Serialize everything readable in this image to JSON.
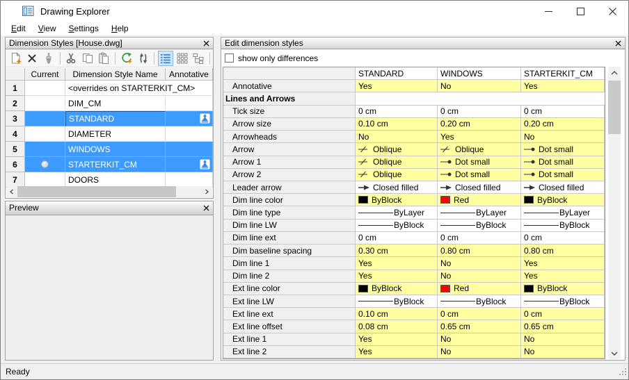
{
  "window": {
    "title": "Drawing Explorer",
    "buttons": [
      "minimize",
      "maximize",
      "close"
    ],
    "status": "Ready"
  },
  "menu": {
    "items": [
      {
        "label": "Edit"
      },
      {
        "label": "View"
      },
      {
        "label": "Settings"
      },
      {
        "label": "Help"
      }
    ]
  },
  "left_panel": {
    "title": "Dimension Styles [House.dwg]",
    "toolbar": [
      {
        "icon": "new-style"
      },
      {
        "icon": "delete"
      },
      {
        "icon": "purge"
      },
      {
        "sep": true
      },
      {
        "icon": "cut"
      },
      {
        "icon": "copy"
      },
      {
        "icon": "paste"
      },
      {
        "sep": true
      },
      {
        "icon": "regenerate"
      },
      {
        "icon": "refresh"
      },
      {
        "sep": true
      },
      {
        "icon": "details-view",
        "active": true
      },
      {
        "icon": "icons-view"
      },
      {
        "icon": "tree-view"
      },
      {
        "sep": true
      }
    ],
    "table": {
      "columns": [
        "",
        "Current",
        "Dimension Style Name",
        "Annotative"
      ],
      "rows": [
        {
          "num": "1",
          "name": "<overrides on STARTERKIT_CM>",
          "current": false,
          "annotative": false,
          "selected": false
        },
        {
          "num": "2",
          "name": "DIM_CM",
          "current": false,
          "annotative": false,
          "selected": false
        },
        {
          "num": "3",
          "name": "STANDARD",
          "current": false,
          "annotative": true,
          "selected": true,
          "focus": true
        },
        {
          "num": "4",
          "name": "DIAMETER",
          "current": false,
          "annotative": false,
          "selected": false
        },
        {
          "num": "5",
          "name": "WINDOWS",
          "current": false,
          "annotative": false,
          "selected": true
        },
        {
          "num": "6",
          "name": "STARTERKIT_CM",
          "current": true,
          "annotative": true,
          "selected": true
        },
        {
          "num": "7",
          "name": "DOORS",
          "current": false,
          "annotative": false,
          "selected": false
        }
      ]
    }
  },
  "preview_panel": {
    "title": "Preview"
  },
  "right_panel": {
    "title": "Edit dimension styles",
    "checkbox_label": "show only differences",
    "checkbox_checked": false,
    "table": {
      "columns": [
        "",
        "STANDARD",
        "WINDOWS",
        "STARTERKIT_CM"
      ],
      "rows": [
        {
          "label": "Annotative",
          "diff": true,
          "cells": [
            {
              "text": "Yes"
            },
            {
              "text": "No"
            },
            {
              "text": "Yes"
            }
          ]
        },
        {
          "label": "Lines and Arrows",
          "category": true
        },
        {
          "label": "Tick size",
          "diff": false,
          "cells": [
            {
              "text": "0 cm"
            },
            {
              "text": "0 cm"
            },
            {
              "text": "0 cm"
            }
          ]
        },
        {
          "label": "Arrow size",
          "diff": true,
          "cells": [
            {
              "text": "0.10 cm"
            },
            {
              "text": "0.20 cm"
            },
            {
              "text": "0.20 cm"
            }
          ]
        },
        {
          "label": "Arrowheads",
          "diff": true,
          "cells": [
            {
              "text": "No"
            },
            {
              "text": "Yes"
            },
            {
              "text": "No"
            }
          ]
        },
        {
          "label": "Arrow",
          "diff": true,
          "cells": [
            {
              "icon": "oblique",
              "text": "Oblique"
            },
            {
              "icon": "oblique",
              "text": "Oblique"
            },
            {
              "icon": "dot-small",
              "text": "Dot small"
            }
          ]
        },
        {
          "label": "Arrow 1",
          "diff": true,
          "cells": [
            {
              "icon": "oblique",
              "text": "Oblique"
            },
            {
              "icon": "dot-small",
              "text": "Dot small"
            },
            {
              "icon": "dot-small",
              "text": "Dot small"
            }
          ]
        },
        {
          "label": "Arrow 2",
          "diff": true,
          "cells": [
            {
              "icon": "oblique",
              "text": "Oblique"
            },
            {
              "icon": "dot-small",
              "text": "Dot small"
            },
            {
              "icon": "dot-small",
              "text": "Dot small"
            }
          ]
        },
        {
          "label": "Leader arrow",
          "diff": false,
          "cells": [
            {
              "icon": "closed-filled",
              "text": "Closed filled"
            },
            {
              "icon": "closed-filled",
              "text": "Closed filled"
            },
            {
              "icon": "closed-filled",
              "text": "Closed filled"
            }
          ]
        },
        {
          "label": "Dim line color",
          "diff": true,
          "cells": [
            {
              "swatch": "#000000",
              "text": "ByBlock"
            },
            {
              "swatch": "#ff0000",
              "text": "Red"
            },
            {
              "swatch": "#000000",
              "text": "ByBlock"
            }
          ]
        },
        {
          "label": "Dim line type",
          "diff": false,
          "cells": [
            {
              "line": true,
              "text": "ByLayer"
            },
            {
              "line": true,
              "text": "ByLayer"
            },
            {
              "line": true,
              "text": "ByLayer"
            }
          ]
        },
        {
          "label": "Dim line LW",
          "diff": false,
          "cells": [
            {
              "line": true,
              "text": "ByBlock"
            },
            {
              "line": true,
              "text": "ByBlock"
            },
            {
              "line": true,
              "text": "ByBlock"
            }
          ]
        },
        {
          "label": "Dim line ext",
          "diff": false,
          "cells": [
            {
              "text": "0 cm"
            },
            {
              "text": "0 cm"
            },
            {
              "text": "0 cm"
            }
          ]
        },
        {
          "label": "Dim baseline spacing",
          "diff": true,
          "cells": [
            {
              "text": "0.30 cm"
            },
            {
              "text": "0.80 cm"
            },
            {
              "text": "0.80 cm"
            }
          ]
        },
        {
          "label": "Dim line 1",
          "diff": true,
          "cells": [
            {
              "text": "Yes"
            },
            {
              "text": "No"
            },
            {
              "text": "Yes"
            }
          ]
        },
        {
          "label": "Dim line 2",
          "diff": true,
          "cells": [
            {
              "text": "Yes"
            },
            {
              "text": "No"
            },
            {
              "text": "Yes"
            }
          ]
        },
        {
          "label": "Ext line color",
          "diff": true,
          "cells": [
            {
              "swatch": "#000000",
              "text": "ByBlock"
            },
            {
              "swatch": "#ff0000",
              "text": "Red"
            },
            {
              "swatch": "#000000",
              "text": "ByBlock"
            }
          ]
        },
        {
          "label": "Ext line LW",
          "diff": false,
          "cells": [
            {
              "line": true,
              "text": "ByBlock"
            },
            {
              "line": true,
              "text": "ByBlock"
            },
            {
              "line": true,
              "text": "ByBlock"
            }
          ]
        },
        {
          "label": "Ext line ext",
          "diff": true,
          "cells": [
            {
              "text": "0.10 cm"
            },
            {
              "text": "0 cm"
            },
            {
              "text": "0 cm"
            }
          ]
        },
        {
          "label": "Ext line offset",
          "diff": true,
          "cells": [
            {
              "text": "0.08 cm"
            },
            {
              "text": "0.65 cm"
            },
            {
              "text": "0.65 cm"
            }
          ]
        },
        {
          "label": "Ext line 1",
          "diff": true,
          "cells": [
            {
              "text": "Yes"
            },
            {
              "text": "No"
            },
            {
              "text": "No"
            }
          ]
        },
        {
          "label": "Ext line 2",
          "diff": true,
          "cells": [
            {
              "text": "Yes"
            },
            {
              "text": "No"
            },
            {
              "text": "No"
            }
          ]
        }
      ]
    }
  },
  "colors": {
    "selection_blue": "#3d9bfd",
    "difference_highlight": "#ffffa2",
    "swatch_black": "#000000",
    "swatch_red": "#ff0000"
  }
}
